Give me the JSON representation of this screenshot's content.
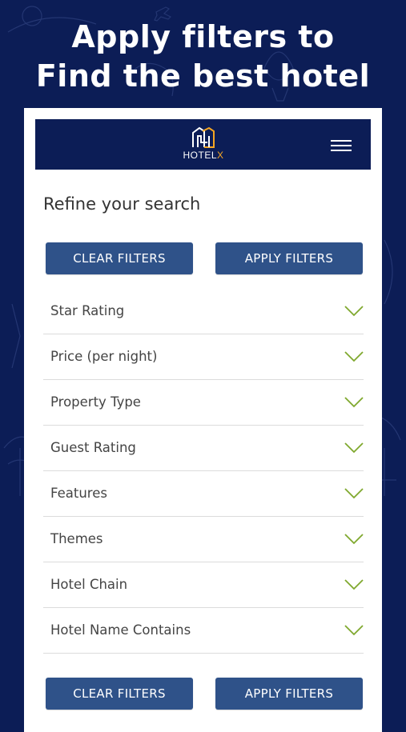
{
  "promo": {
    "headline_line1": "Apply filters to",
    "headline_line2": "Find the best hotel"
  },
  "app_header": {
    "logo_text": "HOTEL",
    "logo_accent": "X"
  },
  "refine": {
    "title": "Refine your search"
  },
  "actions": {
    "clear_label": "CLEAR FILTERS",
    "apply_label": "APPLY FILTERS"
  },
  "filters": [
    {
      "label": "Star Rating"
    },
    {
      "label": "Price (per night)"
    },
    {
      "label": "Property Type"
    },
    {
      "label": "Guest Rating"
    },
    {
      "label": "Features"
    },
    {
      "label": "Themes"
    },
    {
      "label": "Hotel Chain"
    },
    {
      "label": "Hotel Name Contains"
    }
  ],
  "colors": {
    "background": "#0c1d56",
    "button": "#2f5289",
    "chevron": "#7fa82e",
    "logo_accent": "#f5a623"
  },
  "icons": {
    "menu": "hamburger-menu-icon",
    "expand": "chevron-down-icon"
  }
}
